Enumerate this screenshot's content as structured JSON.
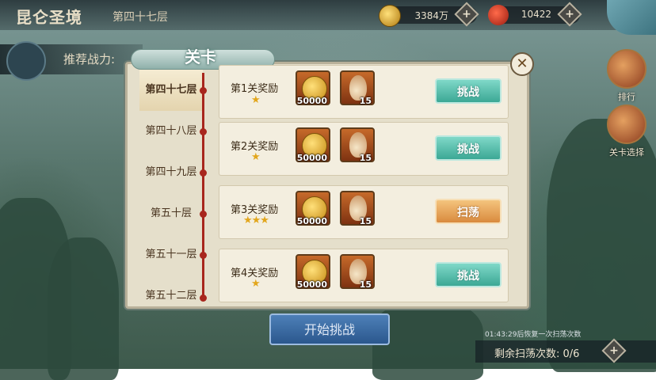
{
  "header": {
    "title": "昆仑圣境",
    "floor": "第四十七层"
  },
  "resources": [
    {
      "icon": "gold-coin-icon",
      "value": "3384万",
      "plus": "+"
    },
    {
      "icon": "red-dragon-icon",
      "value": "10422",
      "plus": "+"
    }
  ],
  "power": {
    "label": "推荐战力:"
  },
  "side": {
    "rank_label": "排行",
    "stage_select_label": "关卡选择"
  },
  "panel": {
    "title": "关卡",
    "close": "✕",
    "levels": [
      "第四十七层",
      "第四十八层",
      "第四十九层",
      "第五十层",
      "第五十一层",
      "第五十二层"
    ],
    "stages": [
      {
        "label": "第1关奖励",
        "stars": "★",
        "coin_qty": "50000",
        "gourd_qty": "15",
        "button": "挑战"
      },
      {
        "label": "第2关奖励",
        "stars": "★",
        "coin_qty": "50000",
        "gourd_qty": "15",
        "button": "挑战"
      },
      {
        "label": "第3关奖励",
        "stars": "★★★",
        "coin_qty": "50000",
        "gourd_qty": "15",
        "button": "扫荡"
      },
      {
        "label": "第4关奖励",
        "stars": "★",
        "coin_qty": "50000",
        "gourd_qty": "15",
        "button": "挑战"
      }
    ]
  },
  "footer": {
    "start_label": "开始挑战",
    "recover_text": "01:43:29后恢复一次扫荡次数",
    "remain_text": "剩余扫荡次数: 0/6",
    "plus": "+"
  },
  "colors": {
    "challenge": "#3ca895",
    "sweep": "#d98a3e",
    "star": "#e2a61c",
    "timeline": "#a8261d"
  }
}
